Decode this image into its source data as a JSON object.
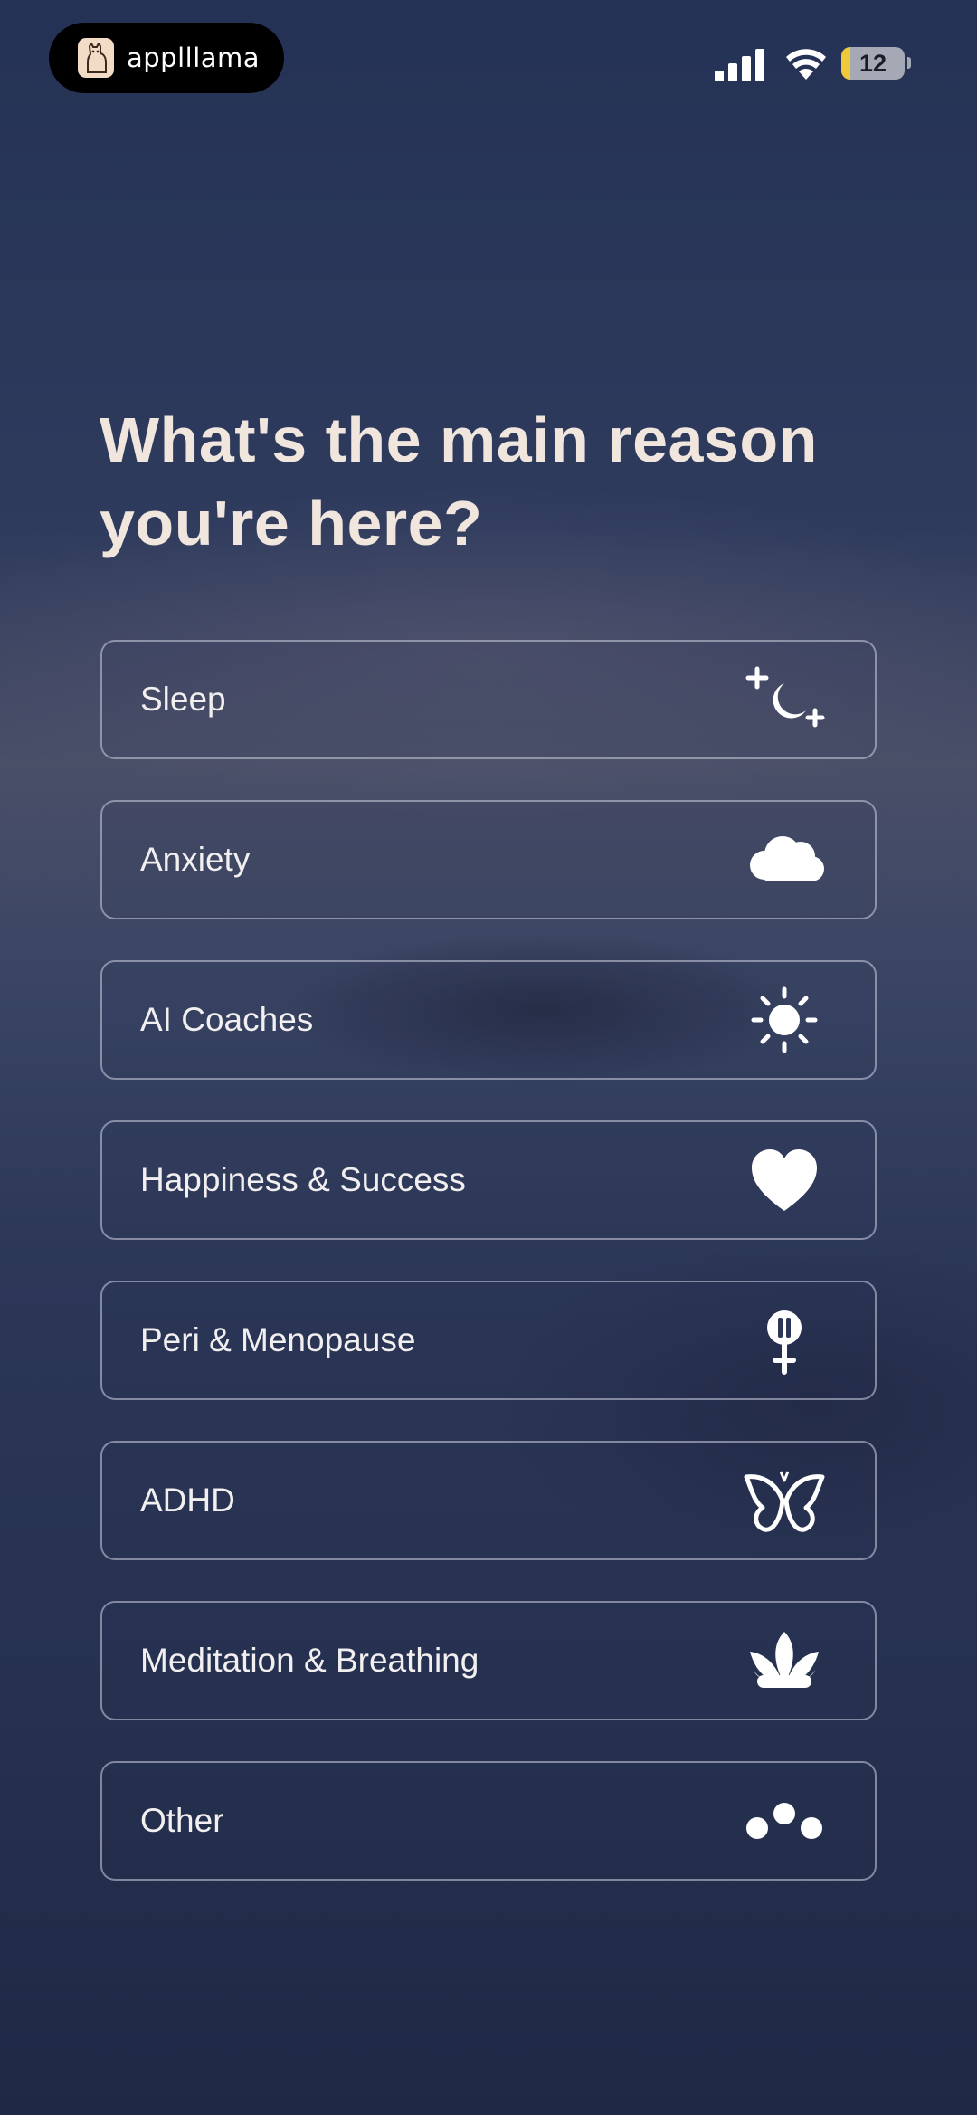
{
  "app_pill": {
    "name": "applllama",
    "icon": "llama-logo-icon"
  },
  "status_bar": {
    "battery": "12",
    "icons": [
      "signal-icon",
      "wifi-icon",
      "battery-icon"
    ]
  },
  "question": "What's the main reason you're here?",
  "options": [
    {
      "label": "Sleep",
      "icon": "moon-stars-icon"
    },
    {
      "label": "Anxiety",
      "icon": "cloud-icon"
    },
    {
      "label": "AI Coaches",
      "icon": "sun-icon"
    },
    {
      "label": "Happiness & Success",
      "icon": "heart-icon"
    },
    {
      "label": "Peri & Menopause",
      "icon": "female-symbol-icon"
    },
    {
      "label": "ADHD",
      "icon": "butterfly-icon"
    },
    {
      "label": "Meditation & Breathing",
      "icon": "lotus-icon"
    },
    {
      "label": "Other",
      "icon": "dots-icon"
    }
  ]
}
